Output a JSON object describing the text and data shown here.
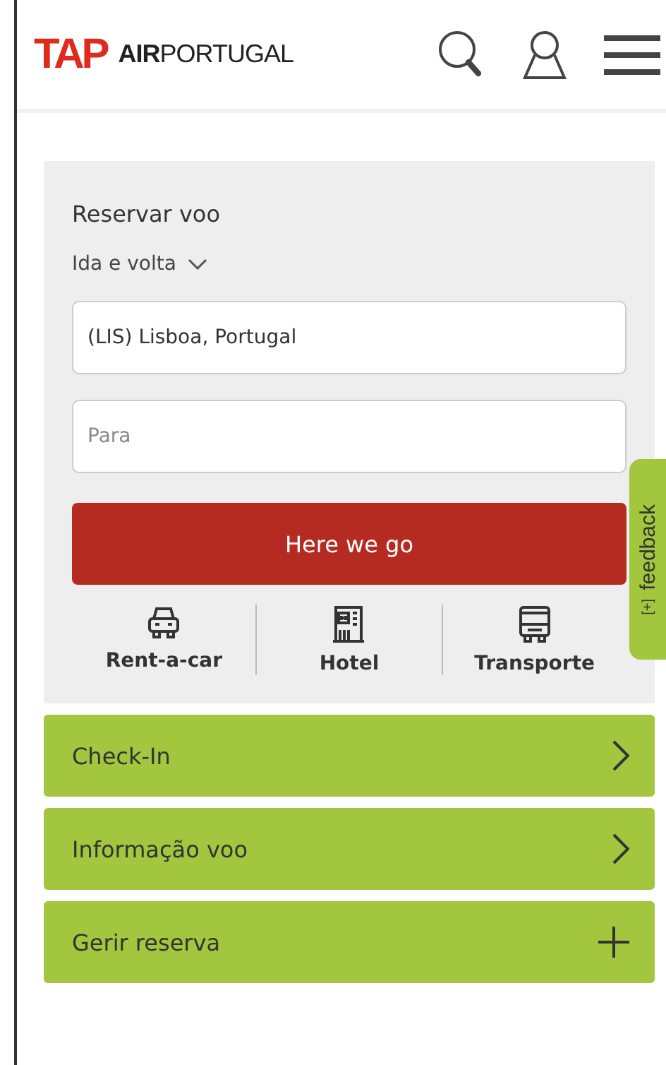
{
  "header": {
    "logo_mark": "TAP",
    "logo_text": "**AIR**PORTUGAL"
  },
  "booking": {
    "title": "Reservar voo",
    "trip_type": "Ida e volta",
    "origin": {
      "value": "(LIS) Lisboa, Portugal"
    },
    "destination": {
      "placeholder": "Para"
    },
    "submit": "Here we go",
    "services": [
      {
        "label": "Rent-a-car",
        "kind": "car"
      },
      {
        "label": "Hotel",
        "kind": "hotel"
      },
      {
        "label": "Transporte",
        "kind": "bus"
      }
    ]
  },
  "feedback": {
    "icon": "[+]",
    "label": "feedback"
  },
  "menu": [
    {
      "label": "Check-In",
      "kind": "link"
    },
    {
      "label": "Informação voo",
      "kind": "link"
    },
    {
      "label": "Gerir reserva",
      "kind": "expand"
    }
  ]
}
